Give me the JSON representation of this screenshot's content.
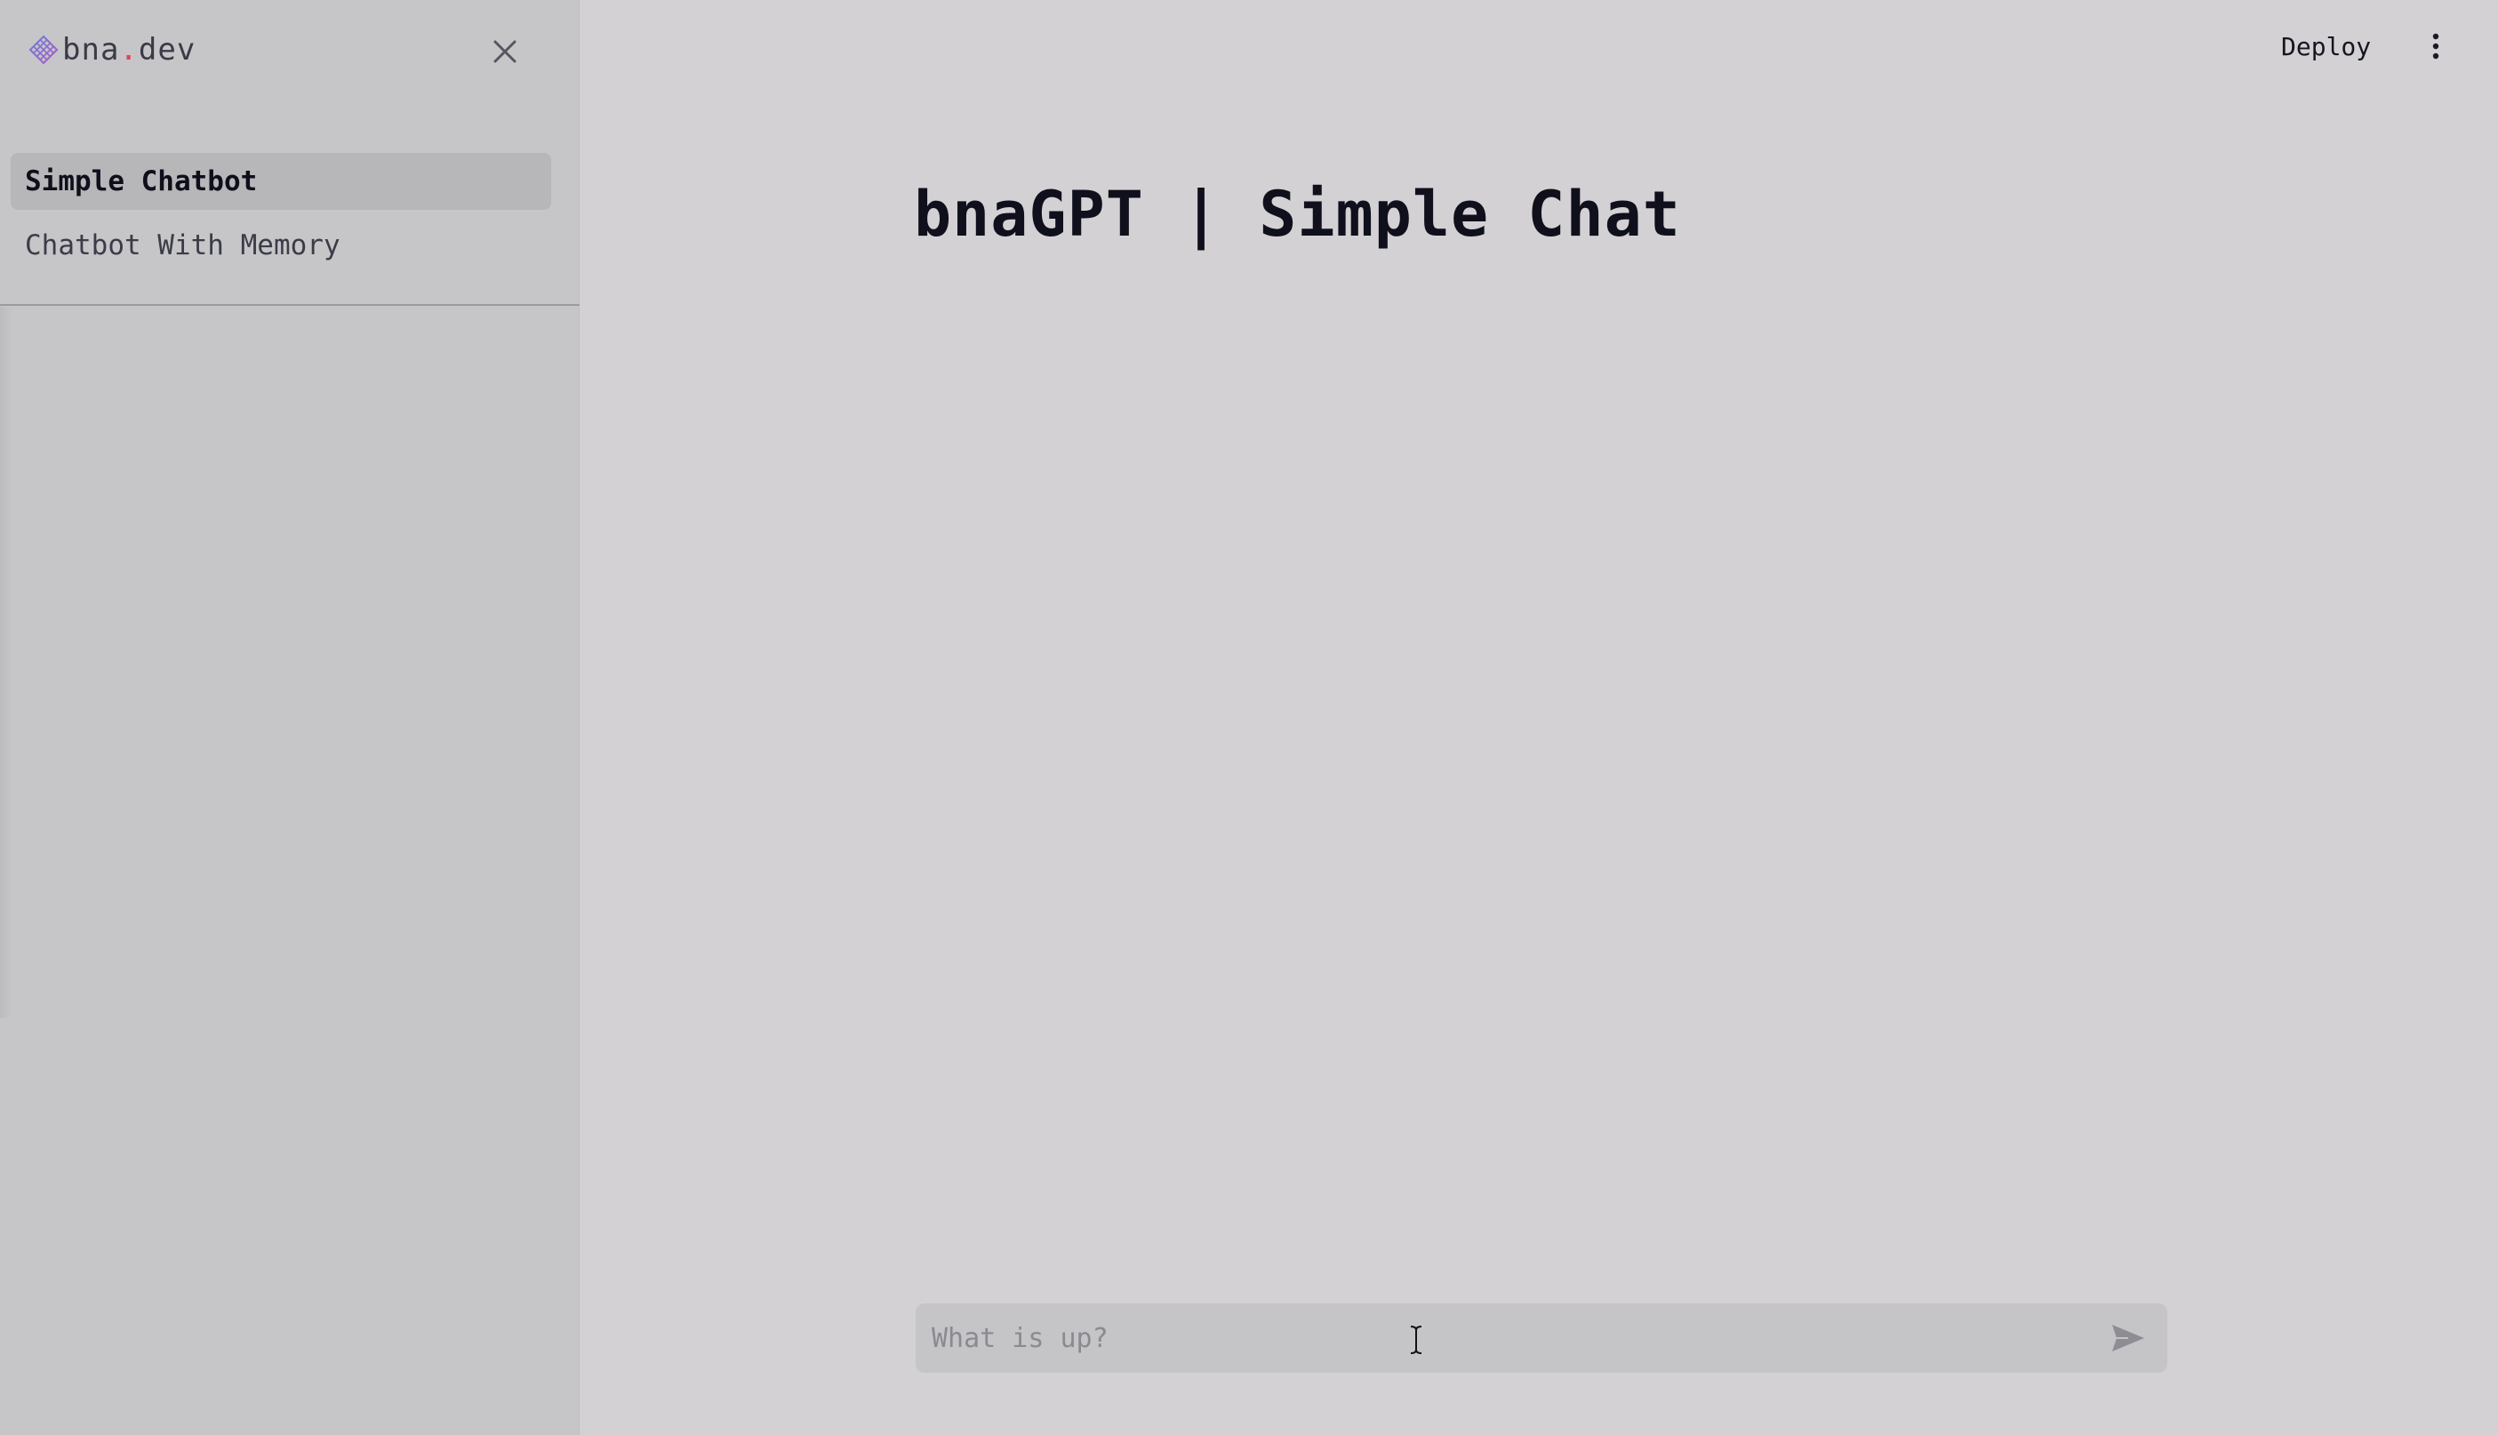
{
  "brand": {
    "name_part1": "bna",
    "dot": ".",
    "name_part2": "dev",
    "accent_color": "#e0454f",
    "logo_icon": "diamond-grid-logo-icon"
  },
  "sidebar": {
    "close_icon": "close-icon",
    "items": [
      {
        "label": "Simple Chatbot",
        "active": true
      },
      {
        "label": "Chatbot With Memory",
        "active": false
      }
    ]
  },
  "topbar": {
    "deploy_label": "Deploy",
    "menu_icon": "vertical-dots-icon"
  },
  "main": {
    "title": "bnaGPT | Simple Chat"
  },
  "chat": {
    "placeholder": "What is up?",
    "value": "",
    "send_icon": "send-icon"
  }
}
